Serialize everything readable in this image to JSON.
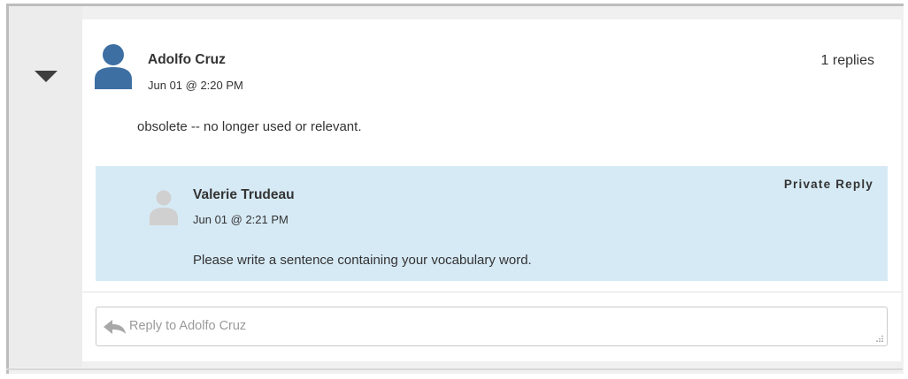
{
  "post": {
    "author": "Adolfo Cruz",
    "date": "Jun 01 @ 2:20 PM",
    "replies": "1 replies",
    "body": "obsolete -- no longer used or relevant."
  },
  "reply": {
    "label": "Private Reply",
    "author": "Valerie Trudeau",
    "date": "Jun 01 @ 2:21 PM",
    "body": "Please write a sentence containing your vocabulary word."
  },
  "reply_input": {
    "placeholder": "Reply to Adolfo Cruz"
  },
  "icons": {
    "toggle": "caret-down-icon",
    "author_avatar": "user-avatar-icon",
    "reply_avatar": "user-avatar-icon",
    "reply": "reply-arrow-icon",
    "resize": "resize-grip-icon"
  },
  "colors": {
    "author_avatar": "#3d6fa3",
    "reply_avatar": "#d0d0d0",
    "reply_background": "#d6eaf5"
  }
}
